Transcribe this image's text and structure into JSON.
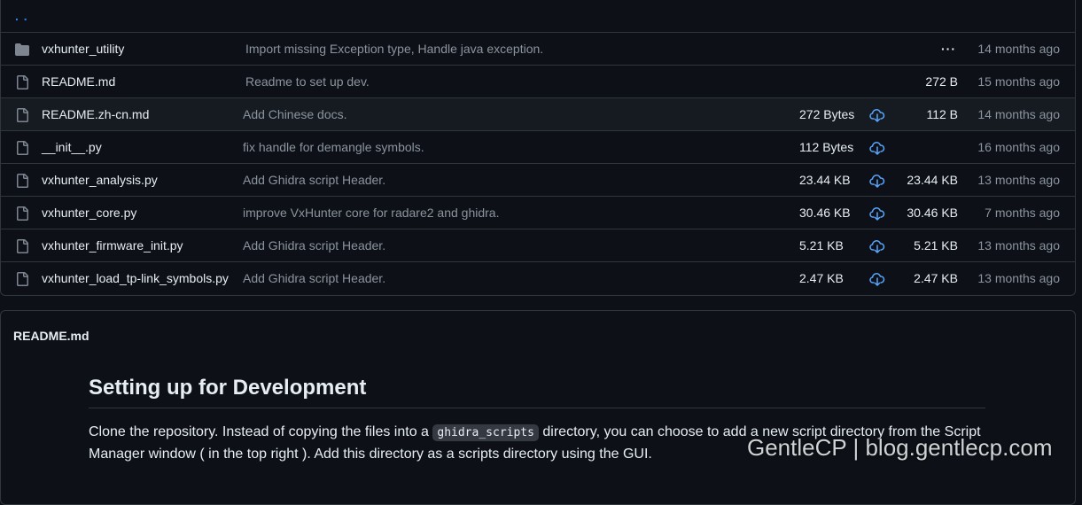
{
  "parent_dir": {
    "label": ". ."
  },
  "files": [
    {
      "type": "dir",
      "name": "vxhunter_utility",
      "message": "Import missing Exception type, Handle java exception.",
      "size1": "",
      "download": false,
      "size2": "···",
      "date": "14 months ago"
    },
    {
      "type": "file",
      "name": "README.md",
      "message": "Readme to set up dev.",
      "size1": "",
      "download": false,
      "size2": "272 B",
      "date": "15 months ago"
    },
    {
      "type": "file",
      "name": "README.zh-cn.md",
      "message": "Add Chinese docs.",
      "size1": "272 Bytes",
      "download": true,
      "size2": "112 B",
      "date": "14 months ago"
    },
    {
      "type": "file",
      "name": "__init__.py",
      "message": "fix handle for demangle symbols.",
      "size1": "112 Bytes",
      "download": true,
      "size2": "",
      "date": "16 months ago"
    },
    {
      "type": "file",
      "name": "vxhunter_analysis.py",
      "message": "Add Ghidra script Header.",
      "size1": "23.44 KB",
      "download": true,
      "size2": "23.44 KB",
      "date": "13 months ago"
    },
    {
      "type": "file",
      "name": "vxhunter_core.py",
      "message": "improve VxHunter core for radare2 and ghidra.",
      "size1": "30.46 KB",
      "download": true,
      "size2": "30.46 KB",
      "date": "7 months ago"
    },
    {
      "type": "file",
      "name": "vxhunter_firmware_init.py",
      "message": "Add Ghidra script Header.",
      "size1": "5.21 KB",
      "download": true,
      "size2": "5.21 KB",
      "date": "13 months ago"
    },
    {
      "type": "file",
      "name": "vxhunter_load_tp-link_symbols.py",
      "message": "Add Ghidra script Header.",
      "size1": "2.47 KB",
      "download": true,
      "size2": "2.47 KB",
      "date": "13 months ago"
    }
  ],
  "readme": {
    "header": "README.md",
    "heading": "Setting up for Development",
    "para_before": "Clone the repository. Instead of copying the files into a ",
    "code": "ghidra_scripts",
    "para_after": " directory, you can choose to add a new script directory from the Script Manager window ( in the top right ). Add this directory as a scripts directory using the GUI."
  },
  "watermark": "GentleCP | blog.gentlecp.com",
  "colors": {
    "background": "#0d1117",
    "border": "#30363d",
    "accent": "#2f81f7",
    "muted": "#8b949e",
    "folder_icon": "#7d8590"
  }
}
